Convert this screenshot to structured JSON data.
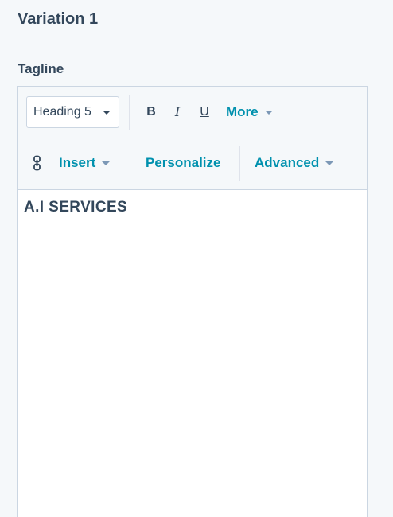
{
  "section": {
    "title": "Variation 1"
  },
  "field": {
    "label": "Tagline"
  },
  "toolbar": {
    "style_select": "Heading 5",
    "bold_label": "B",
    "italic_label": "I",
    "underline_label": "U",
    "more_label": "More",
    "insert_label": "Insert",
    "personalize_label": "Personalize",
    "advanced_label": "Advanced",
    "link_icon": "link-icon",
    "accent_color": "#0091ae"
  },
  "editor": {
    "content": "A.I SERVICES"
  }
}
